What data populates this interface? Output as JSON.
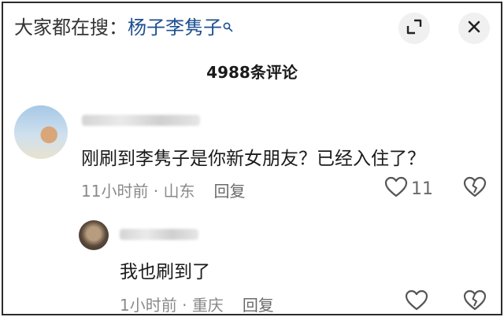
{
  "header": {
    "search_prefix": "大家都在搜：",
    "search_term": "杨子李隽子",
    "search_icon": "magnifier-icon",
    "expand_icon": "expand-corner-icon",
    "close_icon": "close-icon"
  },
  "comment_count": "4988条评论",
  "comment": {
    "text": "刚刷到李隽子是你新女朋友？已经入住了？",
    "time": "11小时前",
    "location": "山东",
    "reply_label": "回复",
    "likes": "11",
    "like_icon": "heart-icon",
    "dislike_icon": "broken-heart-icon"
  },
  "reply": {
    "text": "我也刷到了",
    "time": "1小时前",
    "location": "重庆",
    "reply_label": "回复",
    "like_icon": "heart-icon",
    "dislike_icon": "broken-heart-icon"
  },
  "colors": {
    "search_term": "#1d4f91",
    "meta_text": "#8a8a8a",
    "button_bg": "#f0f0f0"
  }
}
